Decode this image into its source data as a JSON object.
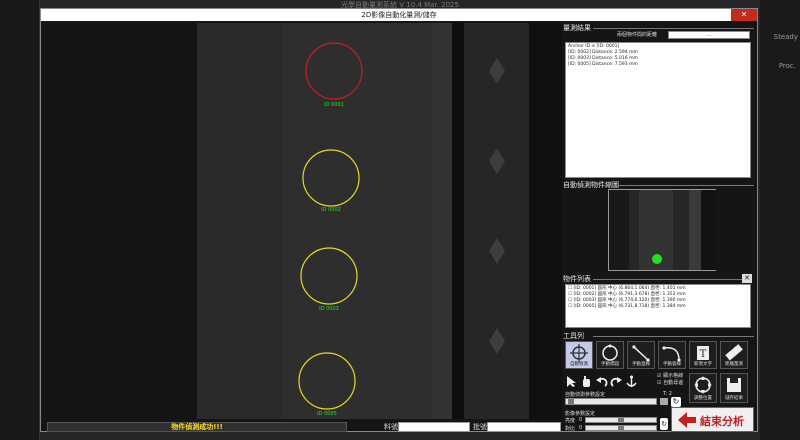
{
  "background": {
    "title": "光學自動量測系統    V 10.4  Mar. 2025",
    "steady": "Steady",
    "proc": "Proc."
  },
  "dialog": {
    "title": "2D影像自動化量測/儲存",
    "close": "✕"
  },
  "image": {
    "circles": [
      {
        "label": "ID 0001",
        "color": "#c81e1e"
      },
      {
        "label": "ID 0002",
        "color": "#e6d81e"
      },
      {
        "label": "ID 0003",
        "color": "#e6d81e"
      },
      {
        "label": "ID 0005",
        "color": "#e6d81e"
      }
    ],
    "label_color": "#22e622"
  },
  "status": {
    "message": "物件偵測成功!!!",
    "material_label": "料號",
    "material_value": "",
    "lot_label": "批號",
    "lot_value": ""
  },
  "panel": {
    "measure_title": "量測結果",
    "distance_label": "兩個物件間的距離",
    "distance_btn": "...",
    "results": [
      "Anchor ID is [ID: 0001]",
      "[ID: 0002] Distance: 2.594 mm",
      "[ID: 0003] Distance: 5.016 mm",
      "[ID: 0005] Distance: 7.593 mm"
    ],
    "preview_title": "自動偵測物件縮圖",
    "objects_title": "物件列表",
    "objects": [
      "[ID: 0001] 圓形 中心 (6.864,1.064) 直徑: 1.401 mm",
      "[ID: 0002] 圓形 中心 (6.791,3.678) 直徑: 1.352 mm",
      "[ID: 0003] 圓形 中心 (6.774,6.120) 直徑: 1.390 mm",
      "[ID: 0005] 圓形 中心 (6.731,8.718) 直徑: 1.384 mm"
    ],
    "toolbar_title": "工具列",
    "tools": [
      "自動偵測",
      "手動標圓",
      "手動直線",
      "手動弧線",
      "新增文字",
      "距離量測"
    ],
    "check_grid": "顯示格線",
    "check_auto": "自動尋邊",
    "param_label": "自動偵測參數設定",
    "param_t": "T: 2",
    "adjust_label": "影像參數設定",
    "bright_label": "亮度",
    "bright_value": "0",
    "contrast_label": "對比",
    "contrast_value": "0",
    "adjust_pos_label": "調整位置",
    "save_label": "儲存結果",
    "end_label": "結束分析"
  }
}
